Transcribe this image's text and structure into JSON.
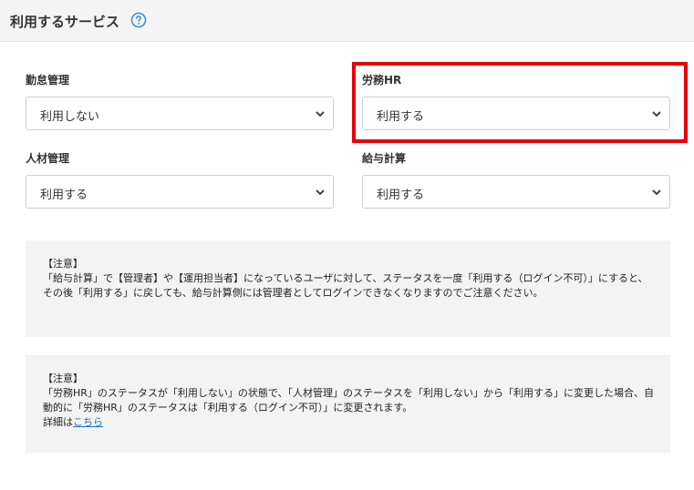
{
  "header": {
    "title": "利用するサービス",
    "help_icon": "question-circle-icon"
  },
  "fields": {
    "attendance": {
      "label": "勤怠管理",
      "value": "利用しない"
    },
    "labor_hr": {
      "label": "労務HR",
      "value": "利用する"
    },
    "talent": {
      "label": "人材管理",
      "value": "利用する"
    },
    "payroll": {
      "label": "給与計算",
      "value": "利用する"
    }
  },
  "notes": [
    {
      "heading": "【注意】",
      "text": "「給与計算」で【管理者】や【運用担当者】になっているユーザに対して、ステータスを一度「利用する（ログイン不可）」にすると、その後「利用する」に戻しても、給与計算側には管理者としてログインできなくなりますのでご注意ください。"
    },
    {
      "heading": "【注意】",
      "text": "「労務HR」のステータスが「利用しない」の状態で、「人材管理」のステータスを「利用しない」から「利用する」に変更した場合、自動的に「労務HR」のステータスは「利用する（ログイン不可）」に変更されます。",
      "detail_prefix": "詳細は",
      "detail_link": "こちら"
    }
  ],
  "colors": {
    "highlight": "#e8000b",
    "link": "#1a73c8",
    "help_icon": "#3a8fd6"
  }
}
